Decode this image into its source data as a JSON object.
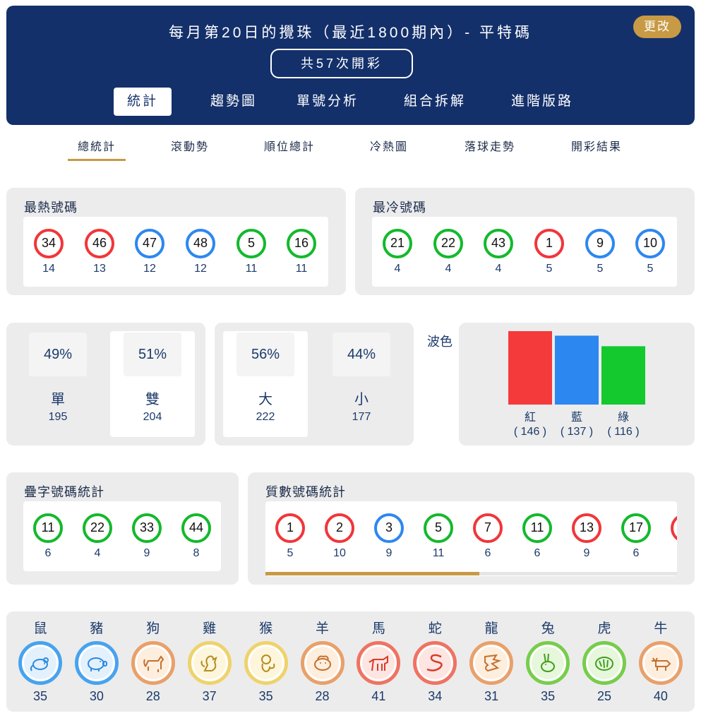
{
  "header": {
    "title": "每月第20日的攪珠（最近1800期內）- 平特碼",
    "change_label": "更改",
    "draw_count": "共57次開彩",
    "tabs": [
      "統計",
      "趨勢圖",
      "單號分析",
      "組合拆解",
      "進階版路"
    ]
  },
  "sub_tabs": [
    "總統計",
    "滾動勢",
    "順位總計",
    "冷熱圖",
    "落球走勢",
    "開彩結果"
  ],
  "hot": {
    "title": "最熱號碼",
    "items": [
      {
        "num": "34",
        "count": "14",
        "color": "red"
      },
      {
        "num": "46",
        "count": "13",
        "color": "red"
      },
      {
        "num": "47",
        "count": "12",
        "color": "blue"
      },
      {
        "num": "48",
        "count": "12",
        "color": "blue"
      },
      {
        "num": "5",
        "count": "11",
        "color": "green"
      },
      {
        "num": "16",
        "count": "11",
        "color": "green"
      }
    ]
  },
  "cold": {
    "title": "最冷號碼",
    "items": [
      {
        "num": "21",
        "count": "4",
        "color": "green"
      },
      {
        "num": "22",
        "count": "4",
        "color": "green"
      },
      {
        "num": "43",
        "count": "4",
        "color": "green"
      },
      {
        "num": "1",
        "count": "5",
        "color": "red"
      },
      {
        "num": "9",
        "count": "5",
        "color": "blue"
      },
      {
        "num": "10",
        "count": "5",
        "color": "blue"
      }
    ]
  },
  "odd_even": [
    {
      "pct": "49%",
      "label": "單",
      "count": "195"
    },
    {
      "pct": "51%",
      "label": "雙",
      "count": "204"
    }
  ],
  "big_small": [
    {
      "pct": "56%",
      "label": "大",
      "count": "222"
    },
    {
      "pct": "44%",
      "label": "小",
      "count": "177"
    }
  ],
  "wave": {
    "title": "波色",
    "colors": {
      "red": "#f53a3c",
      "blue": "#2d87f0",
      "green": "#13c92e"
    }
  },
  "chart_data": {
    "type": "bar",
    "categories": [
      "紅",
      "藍",
      "綠"
    ],
    "values": [
      146,
      137,
      116
    ],
    "value_labels": [
      "( 146 )",
      "( 137 )",
      "( 116 )"
    ],
    "title": "波色",
    "xlabel": "",
    "ylabel": "",
    "grid": false
  },
  "repeat": {
    "title": "疊字號碼統計",
    "items": [
      {
        "num": "11",
        "count": "6",
        "color": "green"
      },
      {
        "num": "22",
        "count": "4",
        "color": "green"
      },
      {
        "num": "33",
        "count": "9",
        "color": "green"
      },
      {
        "num": "44",
        "count": "8",
        "color": "green"
      }
    ]
  },
  "prime": {
    "title": "質數號碼統計",
    "items": [
      {
        "num": "1",
        "count": "5",
        "color": "red"
      },
      {
        "num": "2",
        "count": "10",
        "color": "red"
      },
      {
        "num": "3",
        "count": "9",
        "color": "blue"
      },
      {
        "num": "5",
        "count": "11",
        "color": "green"
      },
      {
        "num": "7",
        "count": "6",
        "color": "red"
      },
      {
        "num": "11",
        "count": "6",
        "color": "green"
      },
      {
        "num": "13",
        "count": "9",
        "color": "red"
      },
      {
        "num": "17",
        "count": "6",
        "color": "green"
      }
    ],
    "scroll_progress": 0.52
  },
  "zodiac": [
    {
      "name": "鼠",
      "count": "35",
      "style": "blue",
      "icon": "rat-icon"
    },
    {
      "name": "豬",
      "count": "30",
      "style": "blue",
      "icon": "pig-icon"
    },
    {
      "name": "狗",
      "count": "28",
      "style": "orange",
      "icon": "dog-icon"
    },
    {
      "name": "雞",
      "count": "37",
      "style": "yellow",
      "icon": "rooster-icon"
    },
    {
      "name": "猴",
      "count": "35",
      "style": "yellow",
      "icon": "monkey-icon"
    },
    {
      "name": "羊",
      "count": "28",
      "style": "orange",
      "icon": "goat-icon"
    },
    {
      "name": "馬",
      "count": "41",
      "style": "red",
      "icon": "horse-icon"
    },
    {
      "name": "蛇",
      "count": "34",
      "style": "red",
      "icon": "snake-icon"
    },
    {
      "name": "龍",
      "count": "31",
      "style": "orange",
      "icon": "dragon-icon"
    },
    {
      "name": "兔",
      "count": "35",
      "style": "green",
      "icon": "rabbit-icon"
    },
    {
      "name": "虎",
      "count": "25",
      "style": "green",
      "icon": "tiger-icon"
    },
    {
      "name": "牛",
      "count": "40",
      "style": "orange",
      "icon": "ox-icon"
    }
  ]
}
